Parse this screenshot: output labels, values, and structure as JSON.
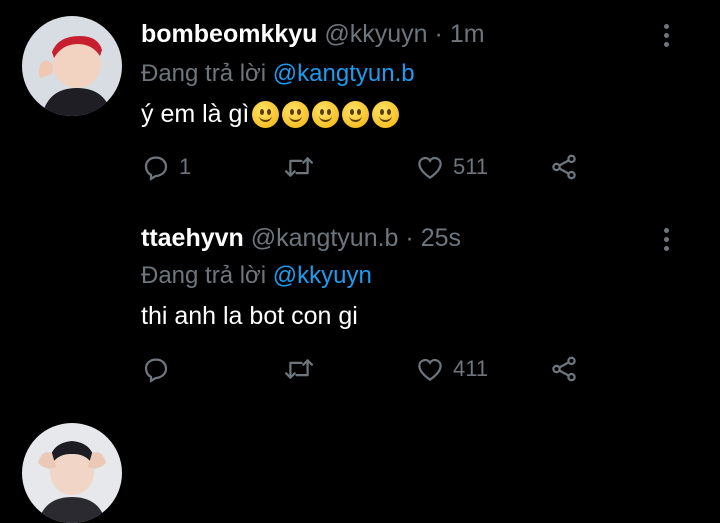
{
  "tweets": [
    {
      "name": "bombeomkkyu",
      "handle": "@kkyuyn",
      "separator": "·",
      "time": "1m",
      "reply_prefix": "Đang trả lời ",
      "reply_to": "@kangtyun.b",
      "text": "ý em là gì",
      "emoji_count": 5,
      "replies": "1",
      "retweets": "",
      "likes": "511"
    },
    {
      "name": "ttaehyvn",
      "handle": "@kangtyun.b",
      "separator": "·",
      "time": "25s",
      "reply_prefix": "Đang trả lời ",
      "reply_to": "@kkyuyn",
      "text": "thi anh la bot con gi",
      "replies": "",
      "retweets": "",
      "likes": "411"
    }
  ],
  "colors": {
    "background": "#000000",
    "name": "#ffffff",
    "muted": "#6e767d",
    "mention": "#1d9bf0"
  },
  "icons": [
    "more-icon",
    "reply-icon",
    "retweet-icon",
    "like-icon",
    "share-icon"
  ]
}
